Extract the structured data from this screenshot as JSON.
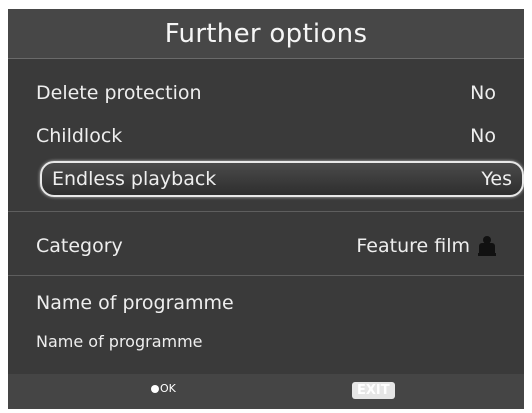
{
  "title": "Further options",
  "rows": [
    {
      "label": "Delete protection",
      "value": "No"
    },
    {
      "label": "Childlock",
      "value": "No"
    },
    {
      "label": "Endless playback",
      "value": "Yes"
    },
    {
      "label": "Category",
      "value": "Feature film",
      "icon": "film-viewer-icon"
    }
  ],
  "programme": {
    "heading": "Name of programme",
    "value": "Name of programme"
  },
  "footer": {
    "ok_label": "OK",
    "exit_label": "EXIT"
  }
}
